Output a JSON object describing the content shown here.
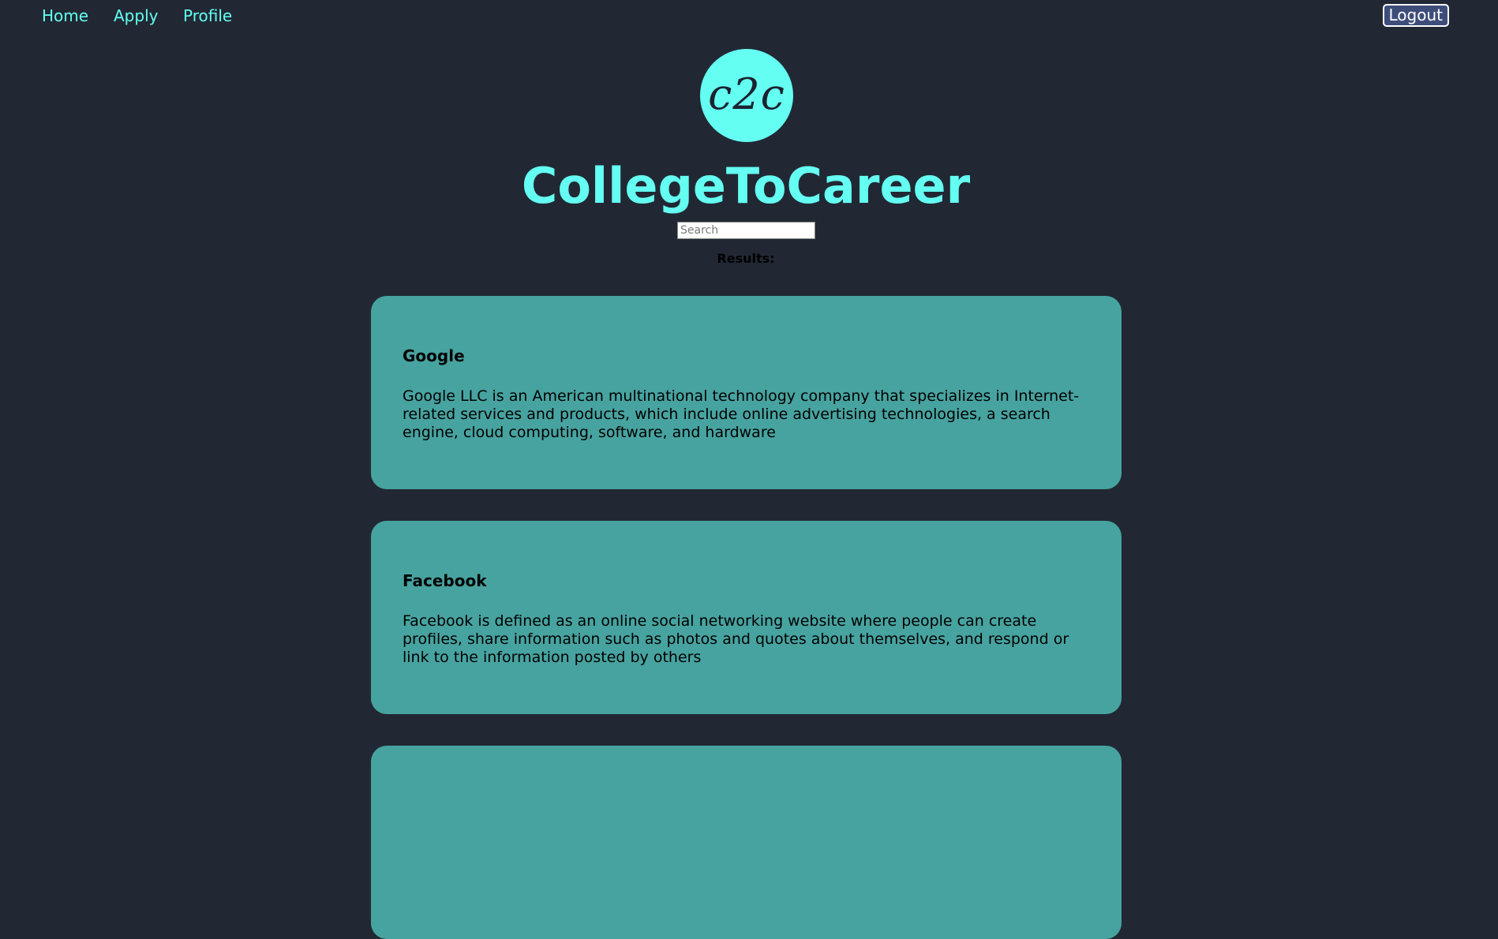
{
  "nav": {
    "links": [
      "Home",
      "Apply",
      "Profile"
    ],
    "logout_label": "Logout"
  },
  "logo": {
    "text": "c2c"
  },
  "header": {
    "title": "CollegeToCareer"
  },
  "search": {
    "placeholder": "Search",
    "value": ""
  },
  "results": {
    "label": "Results:",
    "items": [
      {
        "name": "Google",
        "description": "Google LLC is an American multinational technology company that specializes in Internet-related services and products, which include online advertising technologies, a search engine, cloud computing, software, and hardware"
      },
      {
        "name": "Facebook",
        "description": "Facebook is defined as an online social networking website where people can create profiles, share information such as photos and quotes about themselves, and respond or link to the information posted by others"
      }
    ]
  },
  "colors": {
    "background": "#212834",
    "accent": "#64fff2",
    "card": "#47a3a0",
    "logout_bg": "#3e4d7a"
  }
}
